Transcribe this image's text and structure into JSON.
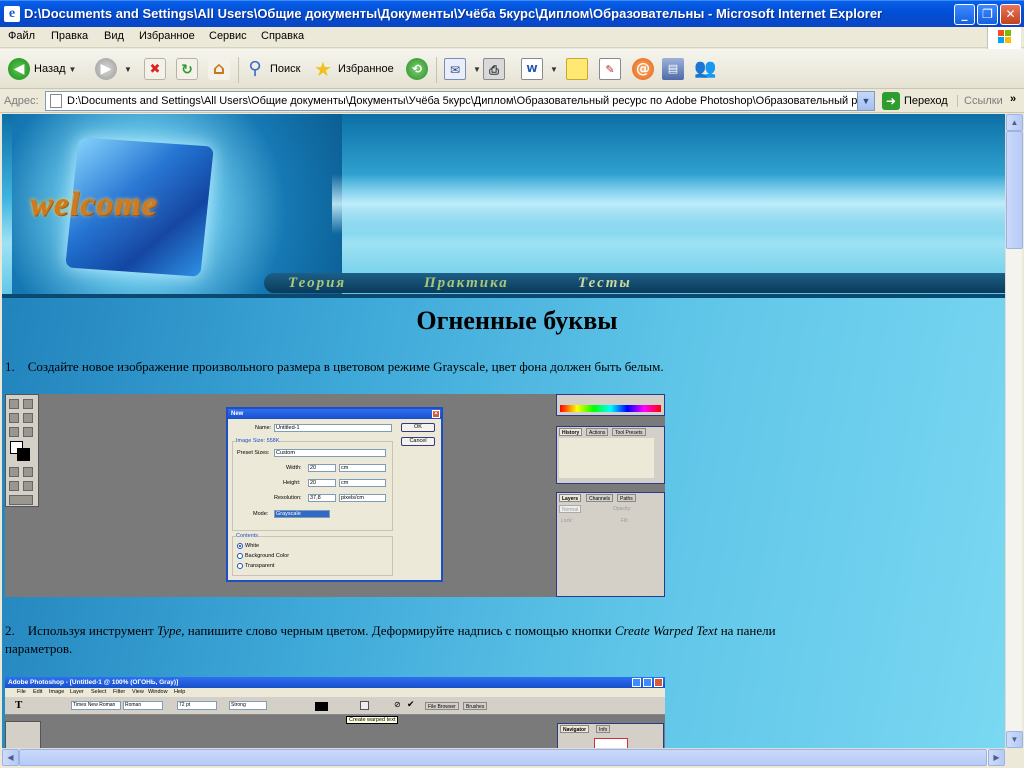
{
  "window": {
    "title": "D:\\Documents and Settings\\All Users\\Общие документы\\Документы\\Учёба 5курс\\Диплом\\Образовательны - Microsoft Internet Explorer"
  },
  "menu": [
    "Файл",
    "Правка",
    "Вид",
    "Избранное",
    "Сервис",
    "Справка"
  ],
  "toolbar": {
    "back_label": "Назад",
    "search_label": "Поиск",
    "favorites_label": "Избранное"
  },
  "address": {
    "label": "Адрес:",
    "value": "D:\\Documents and Settings\\All Users\\Общие документы\\Документы\\Учёба 5курс\\Диплом\\Образовательный ресурс по Adobe Photoshop\\Образовательный р",
    "go_label": "Переход",
    "links_label": "Ссылки"
  },
  "banner": {
    "welcome": "welcome",
    "nav": [
      "Теория",
      "Практика",
      "Тесты"
    ]
  },
  "page": {
    "title": "Огненные буквы",
    "step1_num": "1.",
    "step1_text": "Создайте новое изображение произвольного размера в цветовом режиме Grayscale, цвет фона должен быть белым.",
    "step2_num": "2.",
    "step2_a": "Используя инструмент ",
    "step2_b": "Type",
    "step2_c": ", напишите слово черным цветом. Деформируйте надпись с помощью кнопки ",
    "step2_d": "Create Warped Text",
    "step2_e": " на панели",
    "step2_f": "параметров."
  },
  "shot1": {
    "dialog_title": "New",
    "name_label": "Name:",
    "name_value": "Untitled-1",
    "ok": "OK",
    "cancel": "Cancel",
    "image_size": "Image Size: 558K",
    "preset_label": "Preset Sizes:",
    "preset_value": "Custom",
    "width_label": "Width:",
    "width_value": "20",
    "width_unit": "cm",
    "height_label": "Height:",
    "height_value": "20",
    "height_unit": "cm",
    "res_label": "Resolution:",
    "res_value": "37,8",
    "res_unit": "pixels/cm",
    "mode_label": "Mode:",
    "mode_value": "Grayscale",
    "contents_label": "Contents",
    "contents": [
      "White",
      "Background Color",
      "Transparent"
    ],
    "history_tabs": [
      "History",
      "Actions",
      "Tool Presets"
    ],
    "layers_tabs": [
      "Layers",
      "Channels",
      "Paths"
    ],
    "layers_blend": "Normal",
    "layers_opacity": "Opacity:",
    "layers_lock": "Lock:",
    "layers_fill": "Fill:"
  },
  "shot2": {
    "title": "Adobe Photoshop - [Untitled-1 @ 100% (ОГОНЬ, Gray)]",
    "menu": [
      "File",
      "Edit",
      "Image",
      "Layer",
      "Select",
      "Filter",
      "View",
      "Window",
      "Help"
    ],
    "font_family": "Times New Roman",
    "font_style": "Roman",
    "font_size": "72 pt",
    "aa": "Strong",
    "tooltip": "Create warped text",
    "tabs": [
      "File Browser",
      "Brushes"
    ],
    "nav_tabs": [
      "Navigator",
      "Info"
    ]
  }
}
